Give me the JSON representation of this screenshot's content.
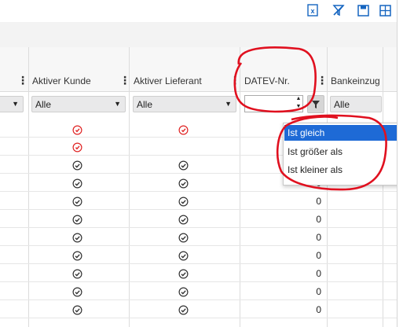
{
  "toolbar": {
    "icons": [
      "excel-icon",
      "filter-off-icon",
      "save-icon",
      "layout-grid-icon"
    ]
  },
  "columns": [
    {
      "title": "Aktiver Kunde",
      "filter": "Alle"
    },
    {
      "title": "Aktiver Lieferant",
      "filter": "Alle"
    },
    {
      "title": "DATEV-Nr.",
      "filter": ""
    },
    {
      "title": "Bankeinzug",
      "filter": "Alle"
    }
  ],
  "first_column_filter": "",
  "dropdown": {
    "items": [
      "Ist gleich",
      "Ist größer als",
      "Ist kleiner als"
    ],
    "selected": "Ist gleich"
  },
  "rows": [
    {
      "kunde": "red",
      "lieferant": "red",
      "datev": ""
    },
    {
      "kunde": "red",
      "lieferant": "",
      "datev": ""
    },
    {
      "kunde": "ok",
      "lieferant": "ok",
      "datev": ""
    },
    {
      "kunde": "ok",
      "lieferant": "ok",
      "datev": "0"
    },
    {
      "kunde": "ok",
      "lieferant": "ok",
      "datev": "0"
    },
    {
      "kunde": "ok",
      "lieferant": "ok",
      "datev": "0"
    },
    {
      "kunde": "ok",
      "lieferant": "ok",
      "datev": "0"
    },
    {
      "kunde": "ok",
      "lieferant": "ok",
      "datev": "0"
    },
    {
      "kunde": "ok",
      "lieferant": "ok",
      "datev": "0"
    },
    {
      "kunde": "ok",
      "lieferant": "ok",
      "datev": "0"
    },
    {
      "kunde": "ok",
      "lieferant": "ok",
      "datev": "0"
    }
  ],
  "colors": {
    "accent": "#1e6ad6",
    "toolbar_icon": "#1565c0",
    "annotation": "#e0101f",
    "check": "#333333",
    "cross": "#e02424"
  }
}
